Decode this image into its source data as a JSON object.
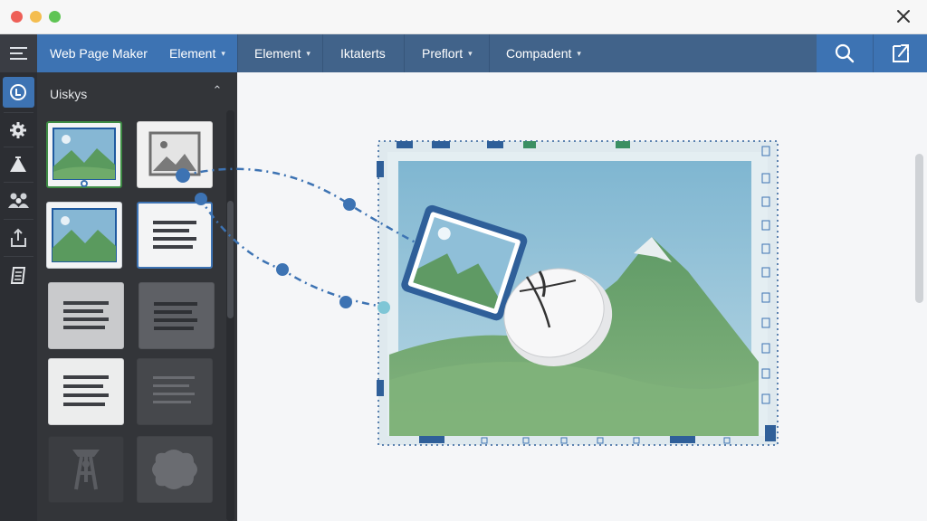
{
  "window": {
    "traffic_lights": {
      "close": "#ee5f57",
      "minimize": "#f4bd4f",
      "zoom": "#5fc454"
    }
  },
  "menubar": {
    "app_name": "Web Page Maker",
    "items": [
      {
        "label": "Element",
        "has_dropdown": true
      },
      {
        "label": "Element",
        "has_dropdown": true
      },
      {
        "label": "Iktaterts",
        "has_dropdown": false
      },
      {
        "label": "Preflort",
        "has_dropdown": true
      },
      {
        "label": "Compadent",
        "has_dropdown": true
      }
    ],
    "caret": "▾",
    "tools": [
      {
        "icon": "search-icon"
      },
      {
        "icon": "export-icon"
      }
    ]
  },
  "rail": {
    "items": [
      {
        "icon": "element-icon",
        "active": true
      },
      {
        "icon": "gear-icon",
        "active": false
      },
      {
        "icon": "shapes-icon",
        "active": false
      },
      {
        "icon": "people-icon",
        "active": false
      },
      {
        "icon": "upload-icon",
        "active": false
      },
      {
        "icon": "book-icon",
        "active": false
      }
    ]
  },
  "panel": {
    "title": "Uiskys",
    "collapse_glyph": "⌃",
    "tiles": [
      {
        "kind": "image",
        "selected": true
      },
      {
        "kind": "image-gray",
        "selected": false
      },
      {
        "kind": "image",
        "selected": false
      },
      {
        "kind": "text",
        "selected": true
      },
      {
        "kind": "text",
        "selected": false
      },
      {
        "kind": "text-dim",
        "selected": false
      },
      {
        "kind": "text",
        "selected": false
      },
      {
        "kind": "text-dim",
        "selected": false
      },
      {
        "kind": "widget",
        "selected": false
      },
      {
        "kind": "shape",
        "selected": false
      }
    ]
  },
  "canvas": {
    "dragged_element": "image-element",
    "cursor": "mouse-icon"
  },
  "colors": {
    "accent": "#3d73b3",
    "menubar": "#41638a",
    "panel": "#333539",
    "rail": "#2c2e33",
    "selection": "#2f5f99",
    "sky": "#8fbfd8",
    "hill": "#5f9a64"
  }
}
